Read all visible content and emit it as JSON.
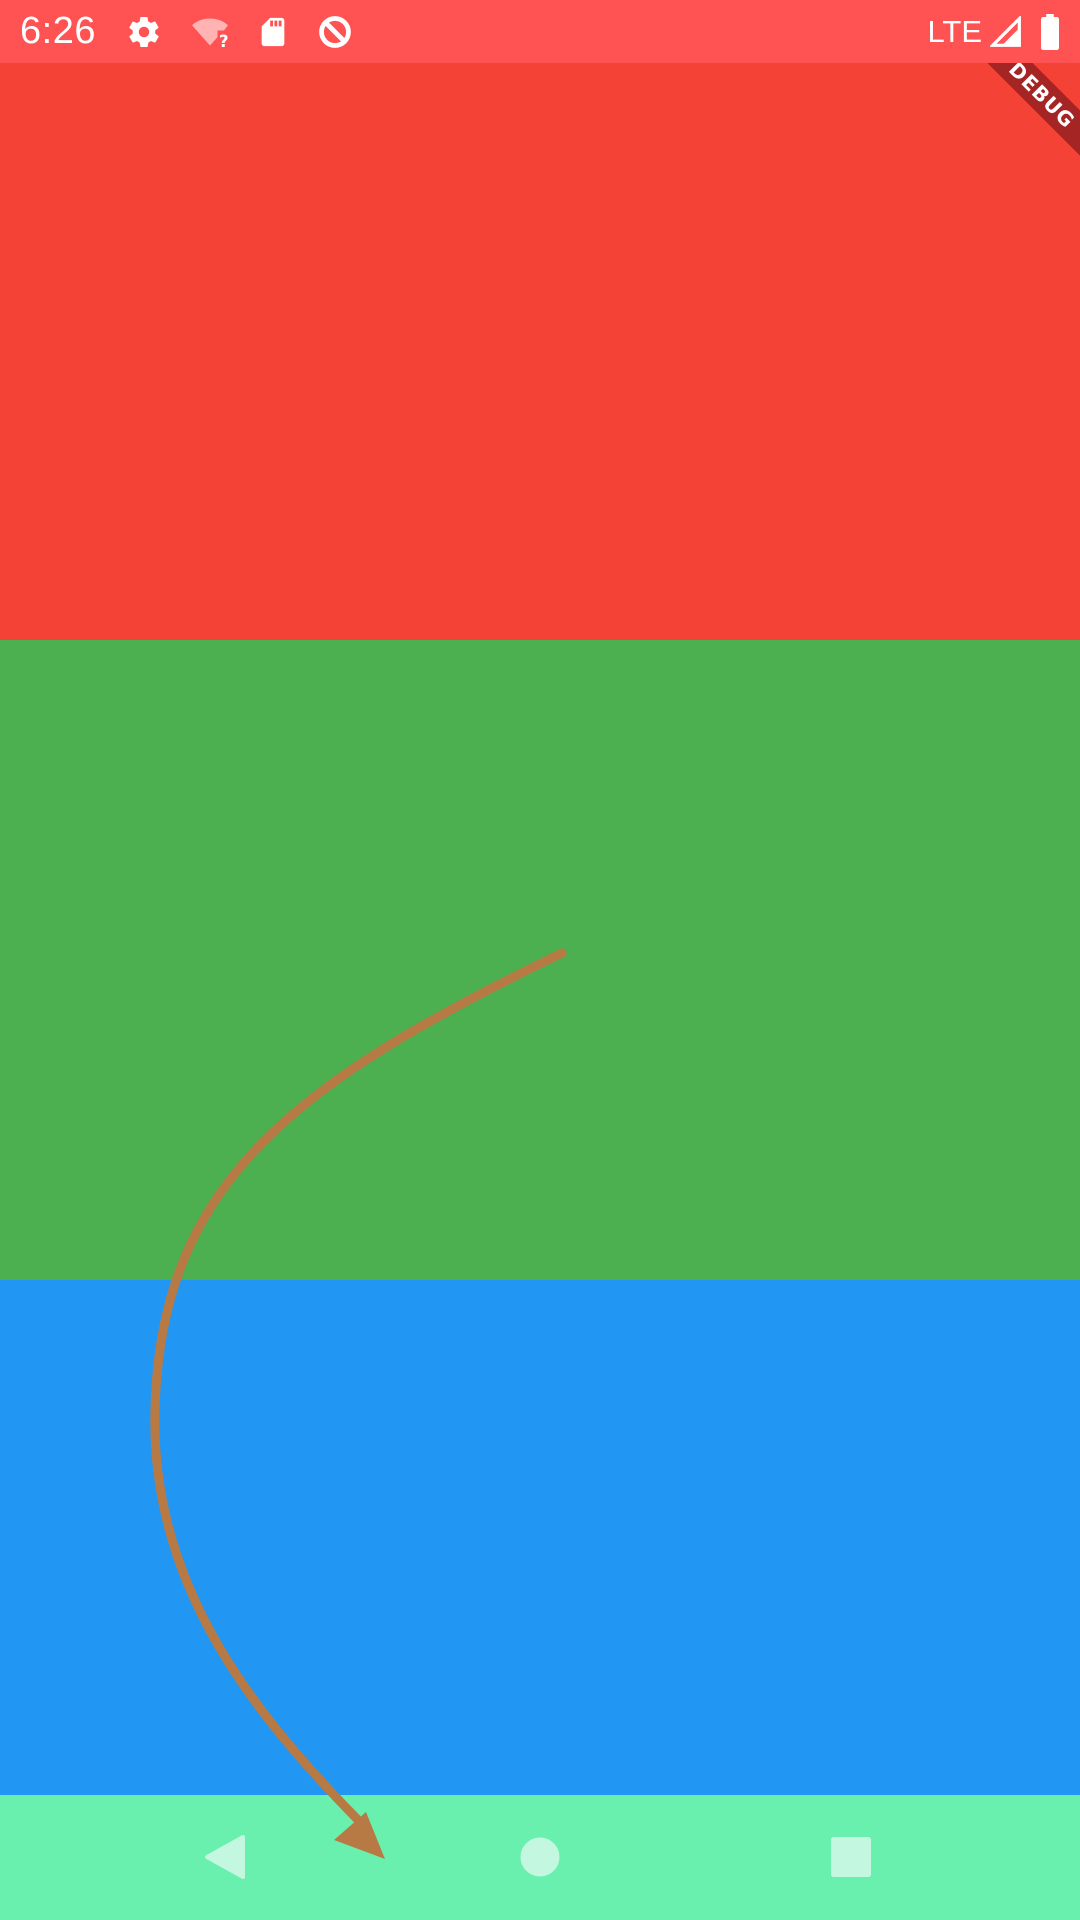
{
  "status_bar": {
    "time": "6:26",
    "network": "LTE",
    "icons": [
      "gear-icon",
      "wifi-unknown-icon",
      "sd-card-icon",
      "data-saver-icon",
      "signal-icon",
      "battery-icon"
    ],
    "color": "#ff5252"
  },
  "debug_banner": {
    "label": "DEBUG"
  },
  "panels": [
    {
      "name": "red",
      "color": "#f44336"
    },
    {
      "name": "green",
      "color": "#4caf50"
    },
    {
      "name": "blue",
      "color": "#2196f3"
    }
  ],
  "nav_bar": {
    "color": "#69f0ae",
    "icon_color": "#c3f7df",
    "buttons": [
      "back-icon",
      "home-icon",
      "recents-icon"
    ]
  },
  "gesture": {
    "color": "#b87a45"
  }
}
